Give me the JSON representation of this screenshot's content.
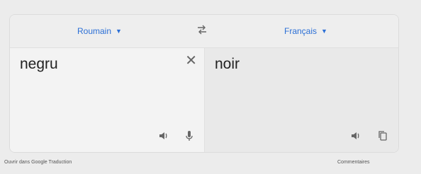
{
  "languages": {
    "source": "Roumain",
    "target": "Français"
  },
  "source": {
    "text": "negru"
  },
  "target": {
    "text": "noir"
  },
  "footer": {
    "open_link": "Ouvrir dans Google Traduction",
    "feedback_link": "Commentaires"
  },
  "colors": {
    "accent": "#2b6fd6",
    "background": "#ececec"
  },
  "icons": {
    "swap": "swap-icon",
    "clear": "close-icon",
    "listen": "speaker-icon",
    "mic": "microphone-icon",
    "copy": "copy-icon"
  }
}
